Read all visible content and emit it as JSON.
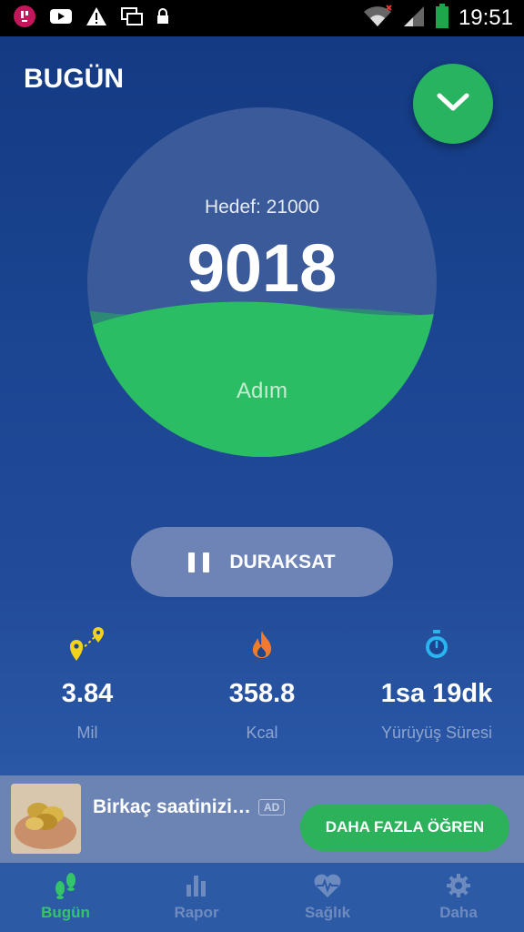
{
  "status_bar": {
    "time": "19:51",
    "icons": [
      "app-notification-icon",
      "youtube-icon",
      "warning-icon",
      "screens-icon",
      "lock-icon",
      "wifi-icon",
      "signal-icon",
      "battery-icon"
    ]
  },
  "header": {
    "title": "BUGÜN",
    "menu_icon": "chevron-down-icon"
  },
  "progress": {
    "goal_label": "Hedef: 21000",
    "steps": "9018",
    "steps_unit": "Adım",
    "fill_fraction": 0.43,
    "fill_color": "#2bbd64"
  },
  "pause_button": {
    "label": "DURAKSAT",
    "icon": "pause-icon"
  },
  "stats": [
    {
      "icon": "route-pin-icon",
      "value": "3.84",
      "label": "Mil",
      "color": "#f2d21a"
    },
    {
      "icon": "flame-icon",
      "value": "358.8",
      "label": "Kcal",
      "color": "#f07a2e"
    },
    {
      "icon": "stopwatch-icon",
      "value": "1sa 19dk",
      "label": "Yürüyüş Süresi",
      "color": "#29b6f0"
    }
  ],
  "ad": {
    "title": "Birkaç saatinizi…",
    "badge": "AD",
    "cta": "DAHA FAZLA ÖĞREN"
  },
  "bottom_nav": [
    {
      "label": "Bugün",
      "icon": "footsteps-icon",
      "active": true
    },
    {
      "label": "Rapor",
      "icon": "bar-chart-icon",
      "active": false
    },
    {
      "label": "Sağlık",
      "icon": "heart-pulse-icon",
      "active": false
    },
    {
      "label": "Daha",
      "icon": "gear-icon",
      "active": false
    }
  ],
  "colors": {
    "accent_green": "#2bb25a",
    "background": "#1b4591",
    "nav_inactive": "#6e8bbf"
  }
}
